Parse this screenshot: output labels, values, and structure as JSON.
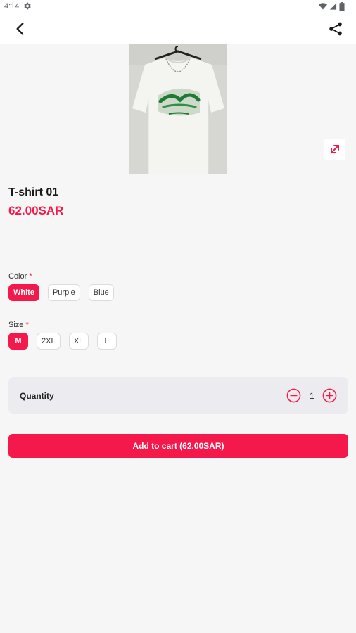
{
  "status_bar": {
    "time": "4:14"
  },
  "product": {
    "title": "T-shirt 01",
    "price": "62.00SAR",
    "image_alt": "white t-shirt with green graphic print"
  },
  "options": {
    "color": {
      "label": "Color",
      "required_mark": "*",
      "values": [
        "White",
        "Purple",
        "Blue"
      ],
      "selected": "White"
    },
    "size": {
      "label": "Size",
      "required_mark": "*",
      "values": [
        "M",
        "2XL",
        "XL",
        "L"
      ],
      "selected": "M"
    }
  },
  "quantity": {
    "label": "Quantity",
    "value": "1"
  },
  "add_to_cart_label": "Add to cart (62.00SAR)",
  "colors": {
    "accent": "#f5194b",
    "background": "#f6f6f6",
    "card": "#ececf0"
  },
  "icons": [
    "settings-icon",
    "wifi-icon",
    "signal-icon",
    "battery-icon",
    "back-arrow-icon",
    "share-icon",
    "expand-icon",
    "minus-circle-icon",
    "plus-circle-icon"
  ]
}
